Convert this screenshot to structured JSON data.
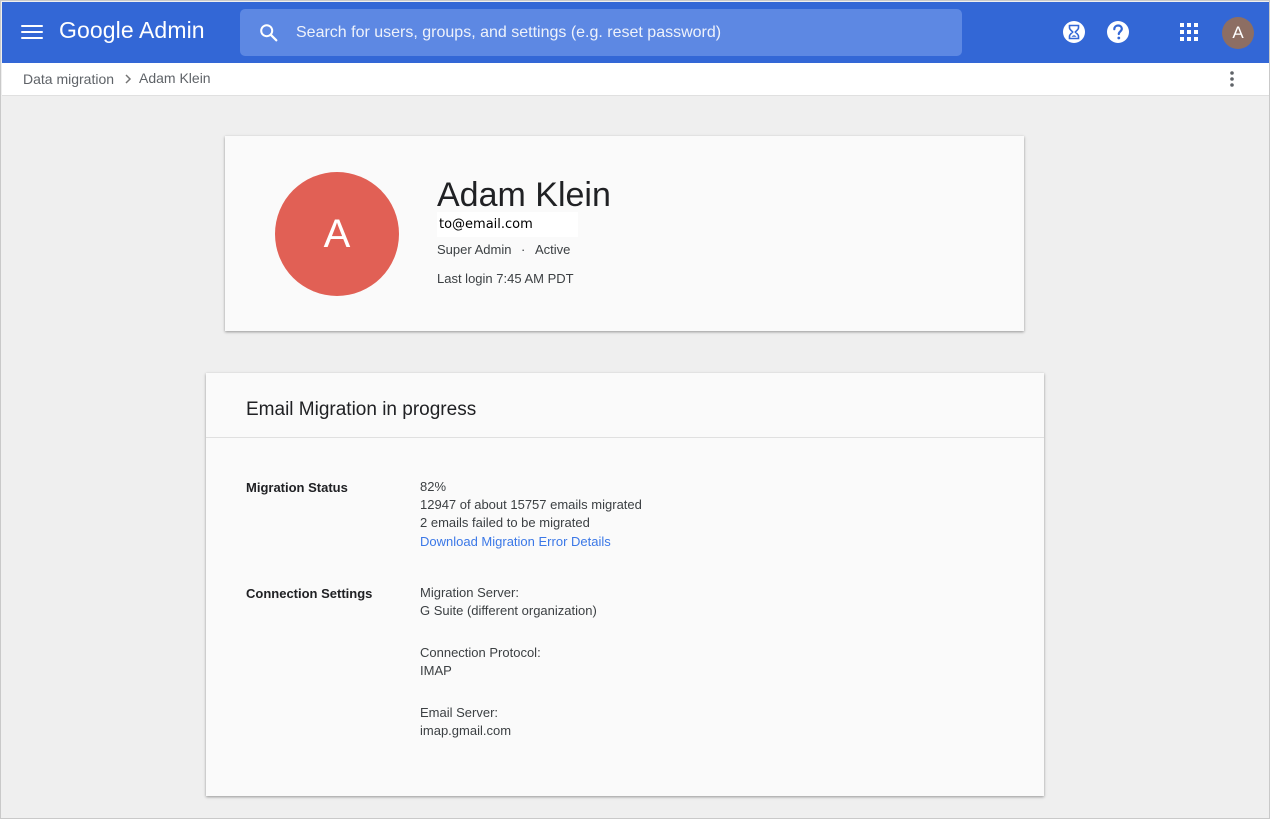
{
  "topbar": {
    "brand": "Google Admin",
    "search_placeholder": "Search for users, groups, and settings (e.g. reset password)",
    "avatar_letter": "A",
    "accent_color": "#3367d6"
  },
  "breadcrumb": {
    "items": [
      "Data migration",
      "Adam Klein"
    ]
  },
  "profile": {
    "avatar_letter": "A",
    "avatar_color": "#e16055",
    "name": "Adam Klein",
    "email": "to@email.com",
    "role": "Super Admin",
    "separator": "·",
    "status": "Active",
    "last_login": "Last login 7:45 AM PDT"
  },
  "migration": {
    "title": "Email Migration in progress",
    "status_label": "Migration Status",
    "percent": "82%",
    "migrated": "12947 of about 15757 emails migrated",
    "failed": "2 emails failed to be migrated",
    "download_link": "Download Migration Error Details",
    "connection_label": "Connection Settings",
    "server_label": "Migration Server:",
    "server_value": "G Suite (different organization)",
    "protocol_label": "Connection Protocol:",
    "protocol_value": "IMAP",
    "email_server_label": "Email Server:",
    "email_server_value": "imap.gmail.com"
  },
  "icons": [
    "menu-icon",
    "search-icon",
    "hourglass-icon",
    "help-icon",
    "apps-icon",
    "chevron-right-icon",
    "more-vert-icon"
  ]
}
